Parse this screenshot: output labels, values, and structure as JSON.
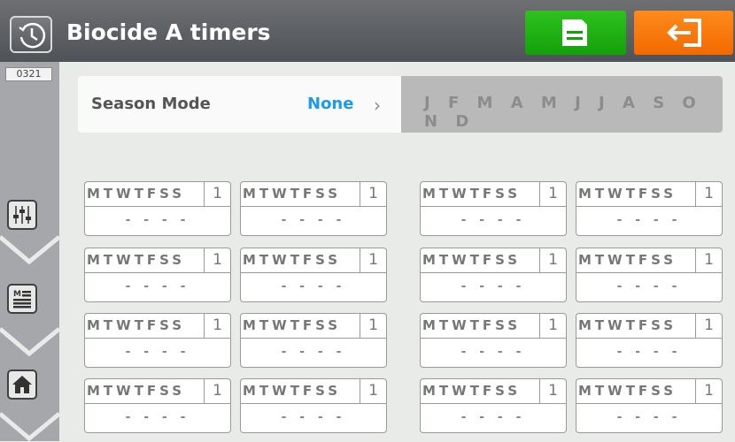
{
  "header": {
    "title": "Biocide A timers",
    "icon": "clock-history-icon"
  },
  "toolbar": {
    "save_icon": "save-icon",
    "exit_icon": "exit-icon"
  },
  "sidebar": {
    "version": "0321",
    "buttons": [
      "sliders-icon",
      "menu-list-icon",
      "home-icon"
    ]
  },
  "season": {
    "label": "Season Mode",
    "value": "None",
    "arrow": "›",
    "months": "J F M A M J J A S O N D"
  },
  "timers": [
    {
      "days": "MTWTFSS",
      "num": "1",
      "time": "- - - -"
    },
    {
      "days": "MTWTFSS",
      "num": "1",
      "time": "- - - -"
    },
    {
      "days": "MTWTFSS",
      "num": "1",
      "time": "- - - -"
    },
    {
      "days": "MTWTFSS",
      "num": "1",
      "time": "- - - -"
    },
    {
      "days": "MTWTFSS",
      "num": "1",
      "time": "- - - -"
    },
    {
      "days": "MTWTFSS",
      "num": "1",
      "time": "- - - -"
    },
    {
      "days": "MTWTFSS",
      "num": "1",
      "time": "- - - -"
    },
    {
      "days": "MTWTFSS",
      "num": "1",
      "time": "- - - -"
    },
    {
      "days": "MTWTFSS",
      "num": "1",
      "time": "- - - -"
    },
    {
      "days": "MTWTFSS",
      "num": "1",
      "time": "- - - -"
    },
    {
      "days": "MTWTFSS",
      "num": "1",
      "time": "- - - -"
    },
    {
      "days": "MTWTFSS",
      "num": "1",
      "time": "- - - -"
    },
    {
      "days": "MTWTFSS",
      "num": "1",
      "time": "- - - -"
    },
    {
      "days": "MTWTFSS",
      "num": "1",
      "time": "- - - -"
    },
    {
      "days": "MTWTFSS",
      "num": "1",
      "time": "- - - -"
    },
    {
      "days": "MTWTFSS",
      "num": "1",
      "time": "- - - -"
    }
  ]
}
